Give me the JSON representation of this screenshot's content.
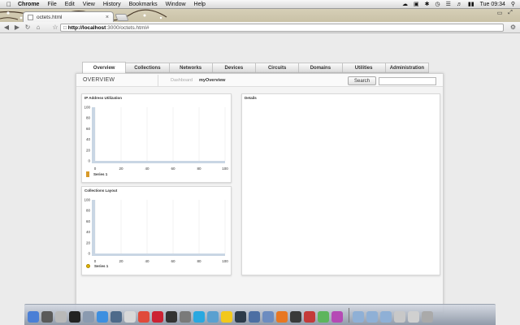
{
  "menubar": {
    "app_name": "Chrome",
    "items": [
      "File",
      "Edit",
      "View",
      "History",
      "Bookmarks",
      "Window",
      "Help"
    ],
    "clock": "Tue 09:34"
  },
  "browser": {
    "tab_title": "octets.html",
    "url_host": "http://localhost",
    "url_rest": ":3000/octets.html#"
  },
  "nav": {
    "tabs": [
      "Overview",
      "Collections",
      "Networks",
      "Devices",
      "Circuits",
      "Domains",
      "Utilities",
      "Administration"
    ],
    "active_index": 0
  },
  "header": {
    "title": "OVERVIEW",
    "breadcrumb": [
      "Dashboard",
      "myOverview"
    ],
    "search_button": "Search",
    "search_value": ""
  },
  "widgets": {
    "ip_title": "IP Address Utilization",
    "collections_title": "Collections Layout",
    "details_title": "Details"
  },
  "chart_data": [
    {
      "type": "bar",
      "title": "IP Address Utilization",
      "xlabel": "",
      "ylabel": "",
      "x_ticks": [
        "0",
        "20",
        "40",
        "60",
        "80",
        "100"
      ],
      "y_ticks": [
        "0",
        "20",
        "40",
        "60",
        "80",
        "100"
      ],
      "xlim": [
        0,
        100
      ],
      "ylim": [
        0,
        100
      ],
      "grid": true,
      "legend_position": "bottom-left",
      "legend_marker": "bar",
      "series": [
        {
          "name": "Series 1",
          "values": []
        }
      ]
    },
    {
      "type": "bar",
      "title": "Collections Layout",
      "xlabel": "",
      "ylabel": "",
      "x_ticks": [
        "0",
        "20",
        "40",
        "60",
        "80",
        "100"
      ],
      "y_ticks": [
        "0",
        "20",
        "40",
        "60",
        "80",
        "100"
      ],
      "xlim": [
        0,
        100
      ],
      "ylim": [
        0,
        100
      ],
      "grid": true,
      "legend_position": "bottom-left",
      "legend_marker": "dot",
      "series": [
        {
          "name": "Series 1",
          "values": []
        }
      ]
    }
  ]
}
